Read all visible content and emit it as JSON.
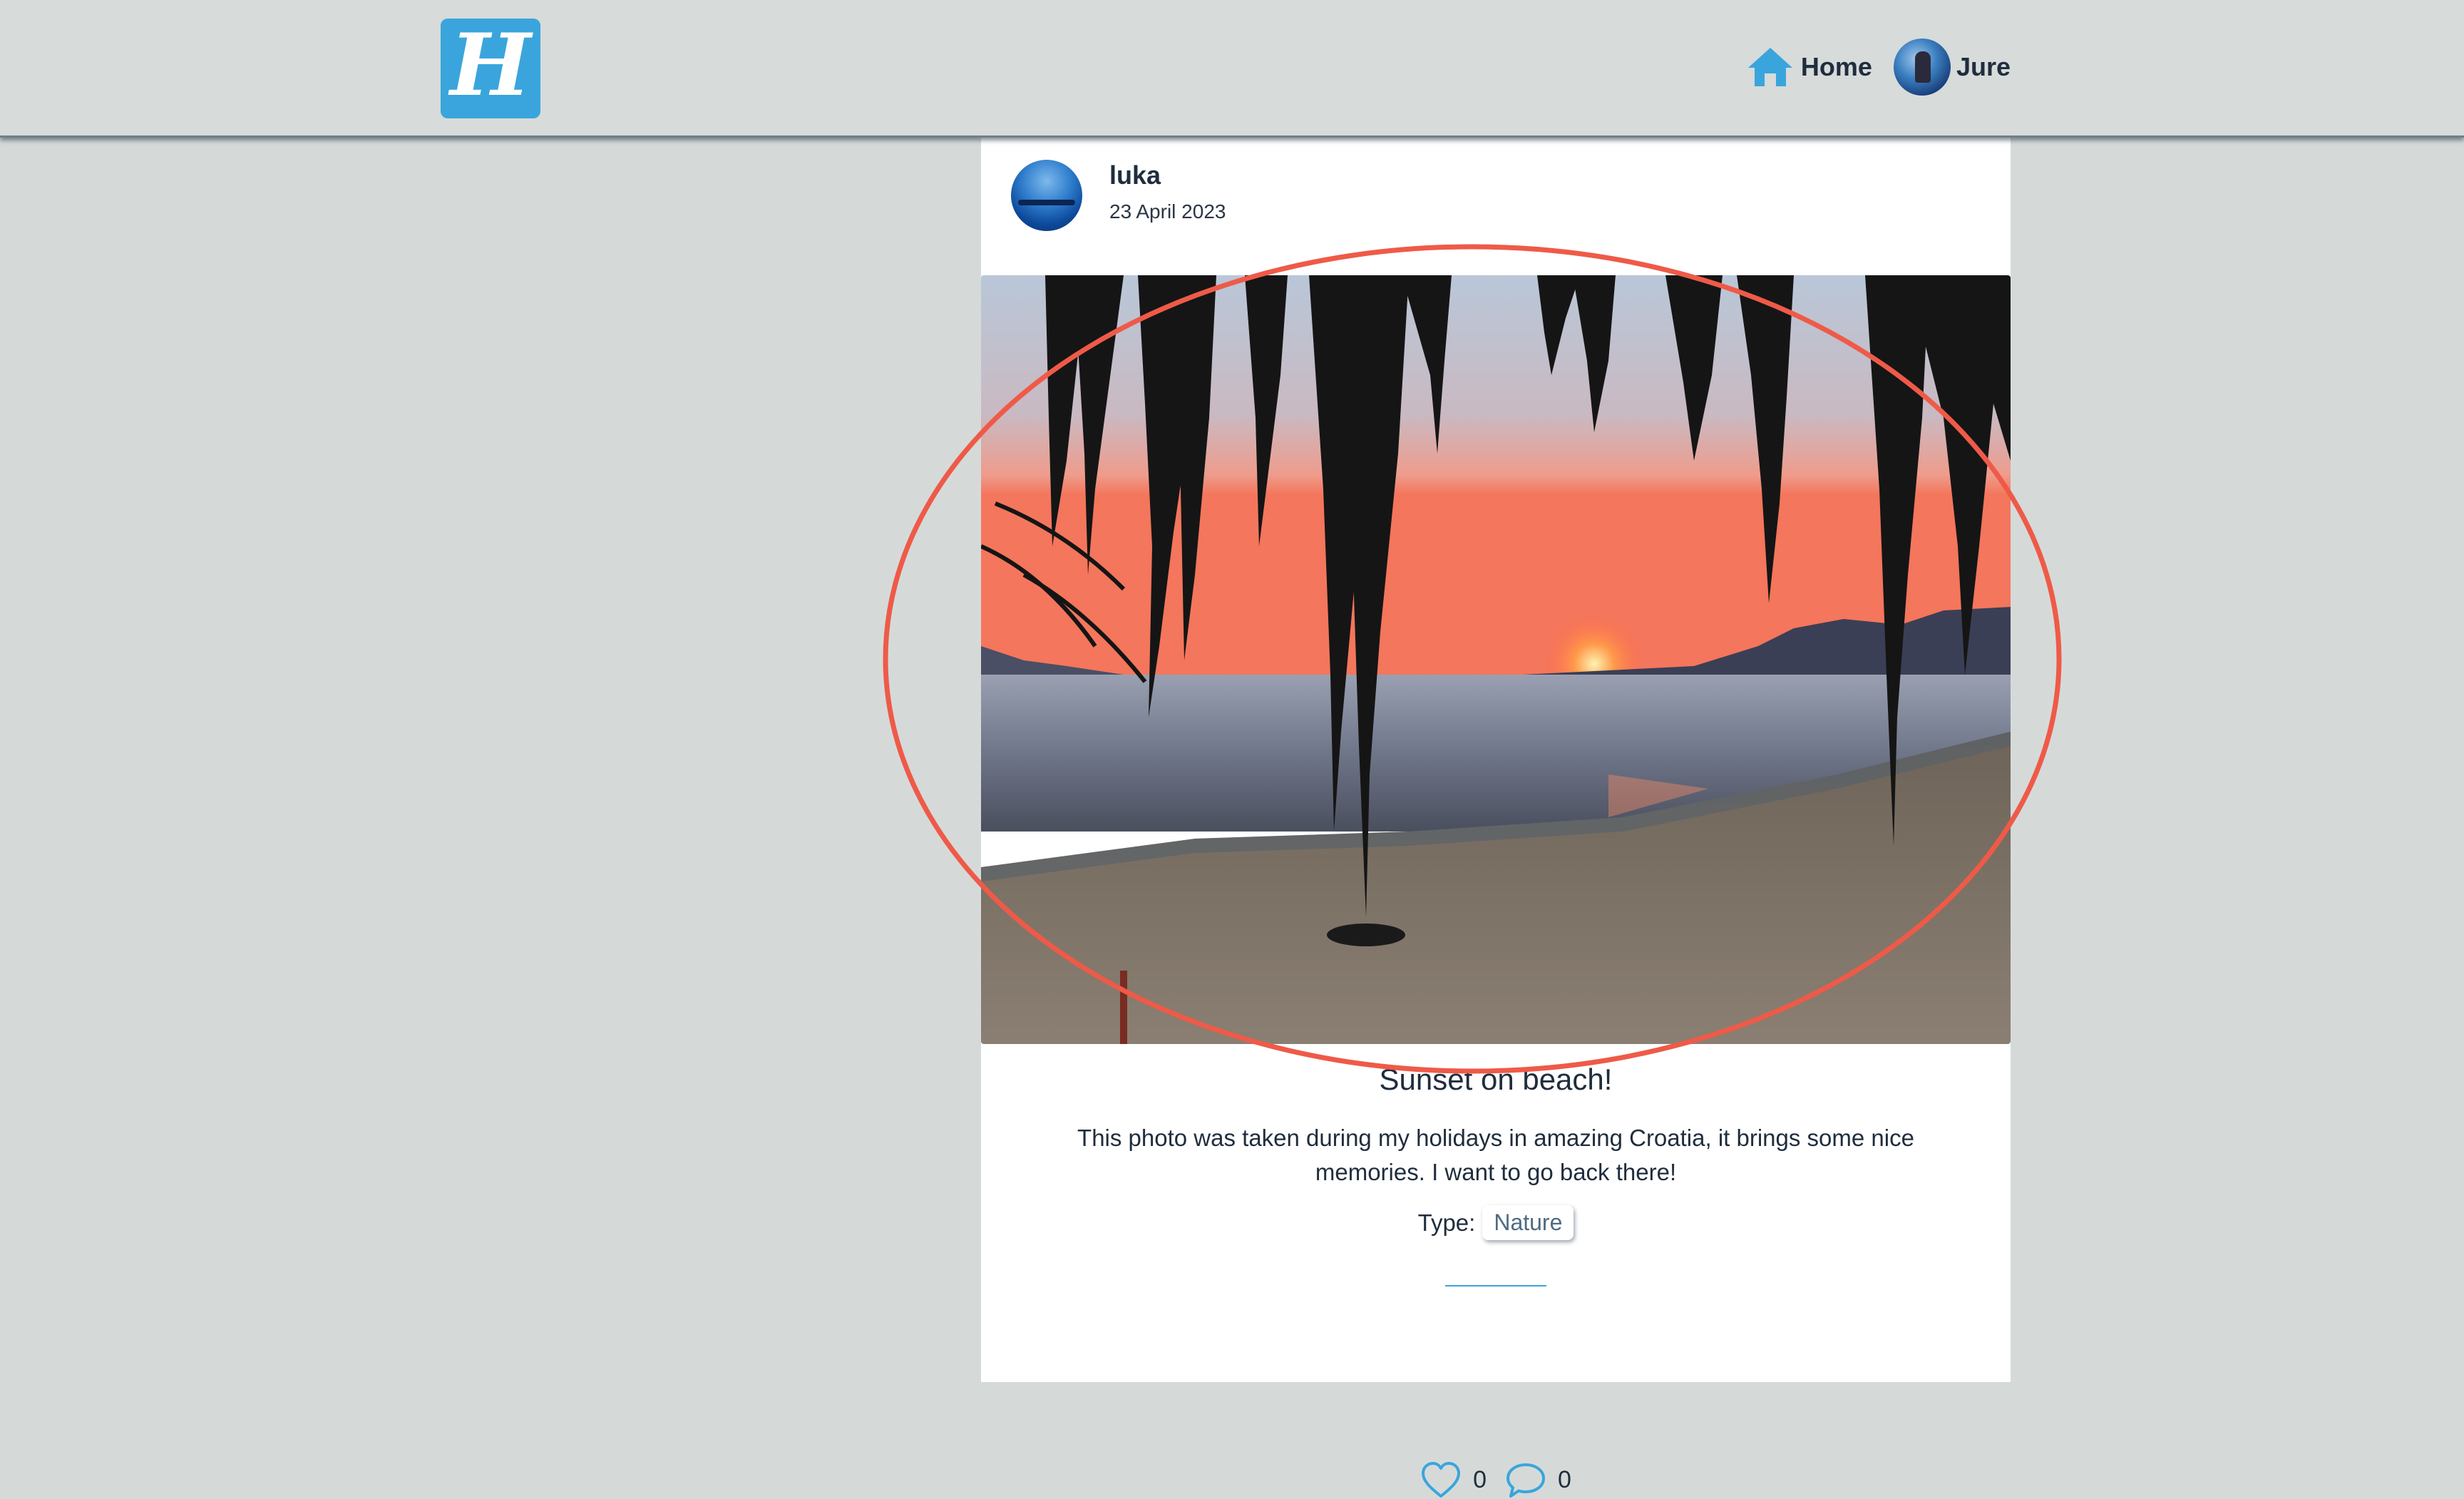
{
  "header": {
    "logo_letter": "H",
    "nav": {
      "home_label": "Home",
      "user_name": "Jure"
    }
  },
  "post": {
    "author": "luka",
    "date": "23 April 2023",
    "title": "Sunset on beach!",
    "description": "This photo was taken during my holidays in amazing Croatia, it brings some nice memories. I want to go back there!",
    "type_label": "Type:",
    "type_value": "Nature",
    "likes": "0",
    "comments": "0"
  },
  "colors": {
    "accent": "#3aa5dc",
    "background": "#d5dad9",
    "highlight_ring": "#ef5a48"
  },
  "icons": {
    "home": "house-icon",
    "like": "heart-icon",
    "comment": "speech-bubble-icon"
  }
}
